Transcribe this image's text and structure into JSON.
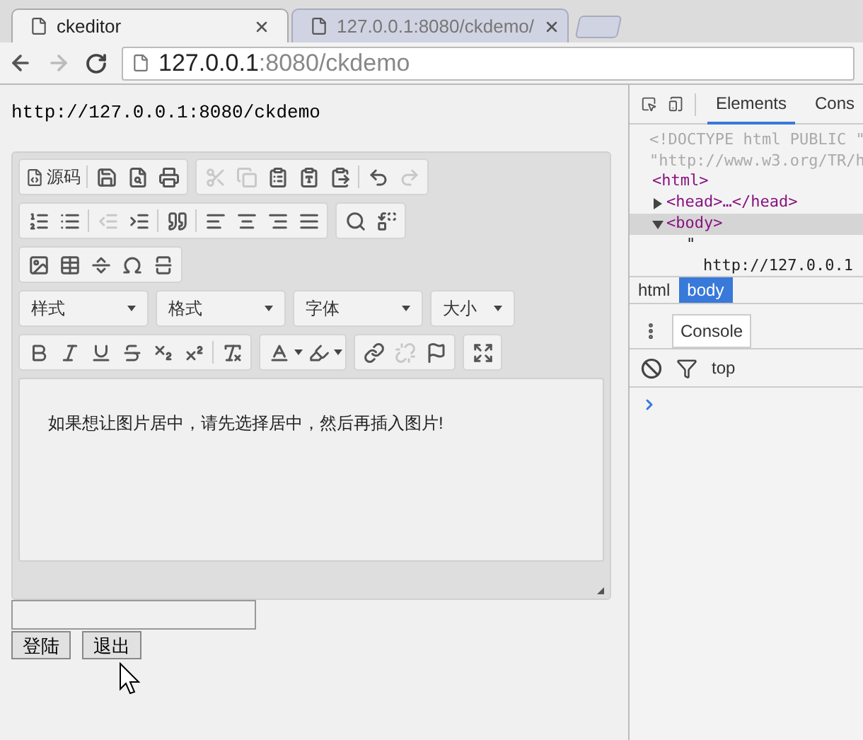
{
  "browser": {
    "tabs": [
      {
        "title": "ckeditor",
        "selected": true
      },
      {
        "title": "127.0.0.1:8080/ckdemo/",
        "selected": false
      }
    ],
    "address": {
      "host": "127.0.0.1",
      "rest": ":8080/ckdemo"
    }
  },
  "page": {
    "url_text": "http://127.0.0.1:8080/ckdemo",
    "editor": {
      "source_label": "源码",
      "combos": [
        "样式",
        "格式",
        "字体",
        "大小"
      ],
      "content": "如果想让图片居中，请先选择居中，然后再插入图片!"
    },
    "buttons": [
      "登陆",
      "退出"
    ]
  },
  "devtools": {
    "tabs": [
      {
        "label": "Elements",
        "selected": true
      },
      {
        "label": "Cons",
        "selected": false
      }
    ],
    "doctype": [
      "<!DOCTYPE html PUBLIC \"",
      "\"http://www.w3.org/TR/h"
    ],
    "dom": [
      {
        "text": "<html>",
        "kind": "tag",
        "children": [
          {
            "text": "<head>…</head>",
            "kind": "tag",
            "expanded": false,
            "selected": false
          },
          {
            "text": "<body>",
            "kind": "tag",
            "expanded": true,
            "selected": true,
            "children": [
              {
                "text": "\"",
                "kind": "text"
              },
              {
                "text": "http://127.0.0.1",
                "kind": "text"
              }
            ]
          }
        ]
      }
    ],
    "breadcrumbs": [
      {
        "label": "html",
        "selected": false
      },
      {
        "label": "body",
        "selected": true
      }
    ],
    "drawer_tabs": [
      {
        "label": "Console",
        "selected": true
      }
    ],
    "context": "top"
  }
}
